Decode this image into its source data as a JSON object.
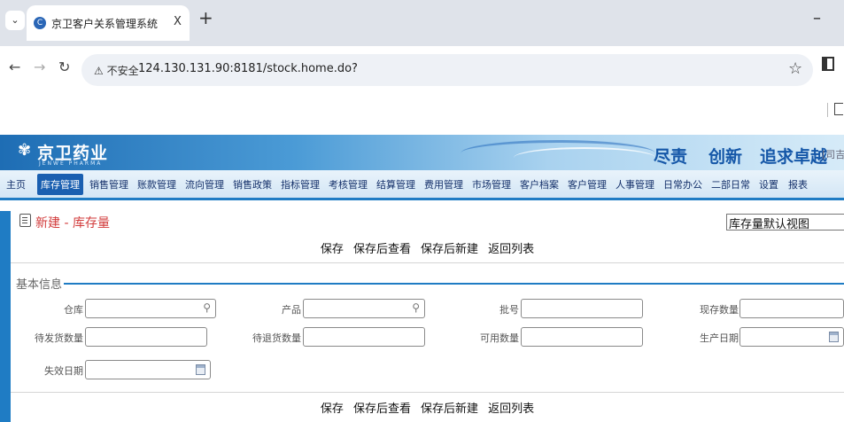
{
  "browser": {
    "tab_title": "京卫客户关系管理系统",
    "tab_close": "X",
    "new_tab": "+",
    "security_label": "不安全",
    "url": "124.130.131.90:8181/stock.home.do?"
  },
  "header": {
    "logo_text": "京卫药业",
    "logo_sub": "JENWE PHARMA",
    "slogan": [
      "尽责",
      "创新",
      "追求卓越"
    ],
    "slogan_tag": "[司吉"
  },
  "menu": {
    "items": [
      "主页",
      "库存管理",
      "销售管理",
      "账款管理",
      "流向管理",
      "销售政策",
      "指标管理",
      "考核管理",
      "结算管理",
      "费用管理",
      "市场管理",
      "客户档案",
      "客户管理",
      "人事管理",
      "日常办公",
      "二部日常",
      "设置",
      "报表"
    ],
    "active": "库存管理"
  },
  "page": {
    "title": "新建 - 库存量",
    "view_select": "库存量默认视图"
  },
  "actions": {
    "save": "保存",
    "save_view": "保存后查看",
    "save_new": "保存后新建",
    "back": "返回列表"
  },
  "form": {
    "section_title": "基本信息",
    "fields": {
      "warehouse": {
        "label": "仓库",
        "value": ""
      },
      "product": {
        "label": "产品",
        "value": ""
      },
      "batch": {
        "label": "批号",
        "value": ""
      },
      "current_qty": {
        "label": "现存数量",
        "value": ""
      },
      "pending_ship_qty": {
        "label": "待发货数量",
        "value": ""
      },
      "pending_return_qty": {
        "label": "待退货数量",
        "value": ""
      },
      "available_qty": {
        "label": "可用数量",
        "value": ""
      },
      "production_date": {
        "label": "生产日期",
        "value": ""
      },
      "expiry_date": {
        "label": "失效日期",
        "value": ""
      }
    }
  }
}
